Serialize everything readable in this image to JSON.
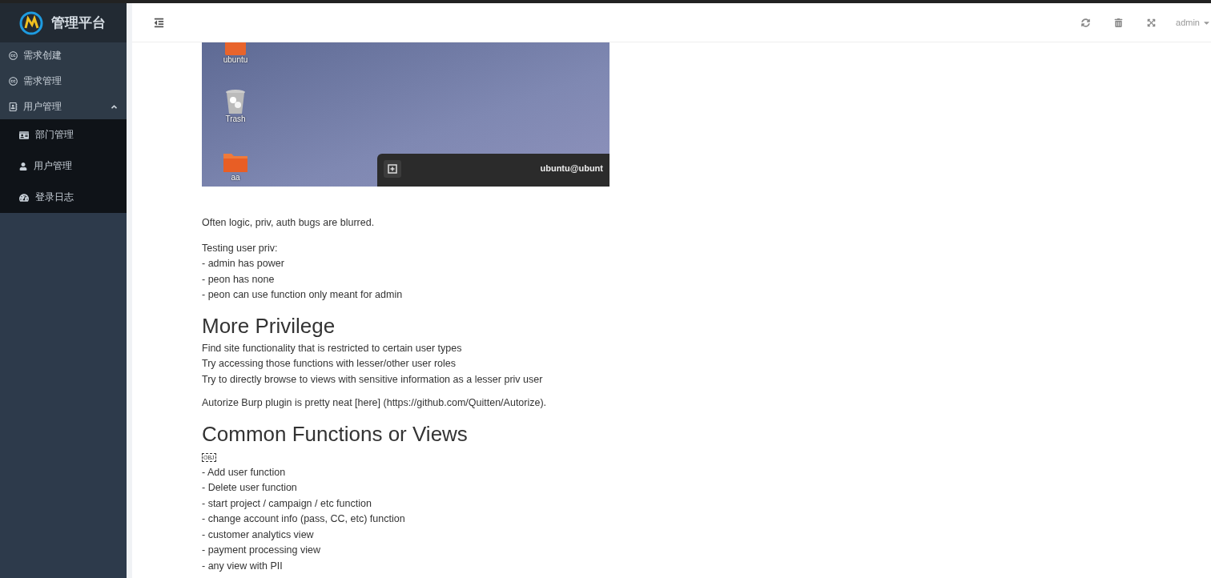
{
  "sidebar": {
    "title": "管理平台",
    "items": [
      {
        "label": "需求创建",
        "kind": "link"
      },
      {
        "label": "需求管理",
        "kind": "link"
      },
      {
        "label": "用户管理",
        "kind": "group",
        "expanded": true,
        "children": [
          {
            "label": "部门管理",
            "kind": "dept"
          },
          {
            "label": "用户管理",
            "kind": "user"
          },
          {
            "label": "登录日志",
            "kind": "log"
          }
        ]
      }
    ]
  },
  "header": {
    "user": "admin"
  },
  "content": [
    {
      "kind": "image",
      "desktop": {
        "icons": [
          {
            "label": "ubuntu",
            "kind": "home"
          },
          {
            "label": "Trash",
            "kind": "trash"
          },
          {
            "label": "aa",
            "kind": "folder"
          }
        ],
        "terminal_title": "ubuntu@ubunt"
      }
    },
    {
      "kind": "p",
      "lines": [
        "Often logic, priv, auth bugs are blurred."
      ]
    },
    {
      "kind": "p",
      "lines": [
        "Testing user priv:",
        "- admin has power",
        "- peon has none",
        "- peon can use function only meant for admin"
      ]
    },
    {
      "kind": "h2",
      "text": "More Privilege"
    },
    {
      "kind": "lines",
      "lines": [
        "Find site functionality that is restricted to certain user types",
        "Try accessing those functions with lesser/other user roles",
        "Try to directly browse to views with sensitive information as a lesser priv user"
      ]
    },
    {
      "kind": "p",
      "lines": [
        "Autorize Burp plugin is pretty neat [here] (https://github.com/Quitten/Autorize)."
      ]
    },
    {
      "kind": "h2",
      "text": "Common Functions or Views"
    },
    {
      "kind": "obj",
      "text": "OBJ"
    },
    {
      "kind": "lines",
      "lines": [
        "- Add user function",
        "- Delete user function",
        "- start project / campaign / etc function",
        "- change account info (pass, CC, etc) function",
        "- customer analytics view",
        "- payment processing view",
        "- any view with PII"
      ]
    }
  ]
}
